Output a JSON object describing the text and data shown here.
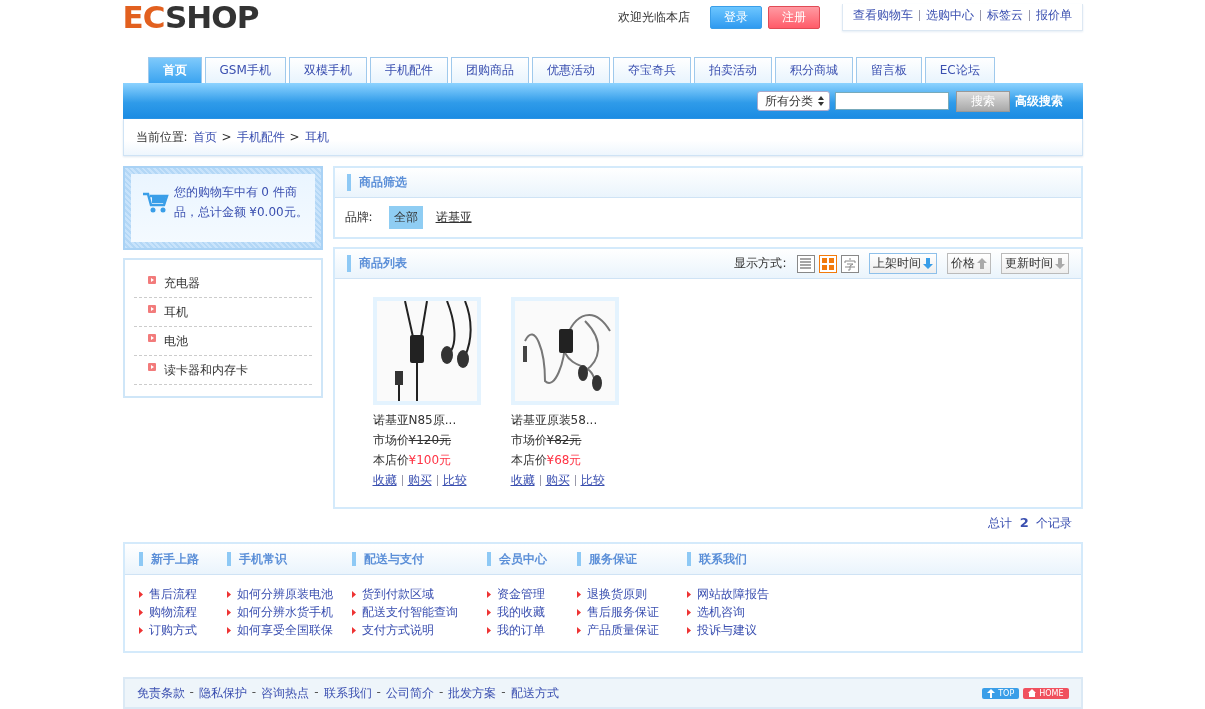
{
  "logo": {
    "prefix": "EC",
    "suffix": "SHOP"
  },
  "welcome": "欢迎光临本店",
  "auth_buttons": [
    {
      "label": "登录",
      "kind": "login"
    },
    {
      "label": "注册",
      "kind": "register"
    }
  ],
  "top_links": [
    "查看购物车",
    "选购中心",
    "标签云",
    "报价单"
  ],
  "nav_tabs": [
    {
      "label": "首页",
      "selected": true
    },
    {
      "label": "GSM手机",
      "selected": false
    },
    {
      "label": "双模手机",
      "selected": false
    },
    {
      "label": "手机配件",
      "selected": false
    },
    {
      "label": "团购商品",
      "selected": false
    },
    {
      "label": "优惠活动",
      "selected": false
    },
    {
      "label": "夺宝奇兵",
      "selected": false
    },
    {
      "label": "拍卖活动",
      "selected": false
    },
    {
      "label": "积分商城",
      "selected": false
    },
    {
      "label": "留言板",
      "selected": false
    },
    {
      "label": "EC论坛",
      "selected": false
    }
  ],
  "search": {
    "category": "所有分类",
    "button": "搜索",
    "advanced": "高级搜索"
  },
  "breadcrumb": {
    "label": "当前位置:",
    "items": [
      "首页",
      "手机配件",
      "耳机"
    ],
    "separator": ">"
  },
  "cart": {
    "text": "您的购物车中有 0 件商品，总计金额 ¥0.00元。"
  },
  "categories": [
    "充电器",
    "耳机",
    "电池",
    "读卡器和内存卡"
  ],
  "filter": {
    "title": "商品筛选",
    "label": "品牌:",
    "brands": [
      {
        "label": "全部",
        "selected": true
      },
      {
        "label": "诺基亚",
        "selected": false
      }
    ]
  },
  "product_list": {
    "title": "商品列表",
    "display_label": "显示方式:",
    "display_modes": [
      {
        "kind": "list",
        "selected": false
      },
      {
        "kind": "grid",
        "selected": true
      },
      {
        "kind": "text",
        "selected": false
      }
    ],
    "sorts": [
      {
        "label": "上架时间",
        "descending": true,
        "selected": true
      },
      {
        "label": "价格",
        "descending": false,
        "selected": false
      },
      {
        "label": "更新时间",
        "descending": true,
        "selected": false
      }
    ],
    "products": [
      {
        "kind": "picture",
        "name": "诺基亚N85原...",
        "market_label": "市场价",
        "market_price": "¥120元",
        "shop_label": "本店价",
        "shop_price": "¥100元",
        "actions": [
          "收藏",
          "购买",
          "比较"
        ]
      },
      {
        "kind": "picture",
        "name": "诺基亚原装58...",
        "market_label": "市场价",
        "market_price": "¥82元",
        "shop_label": "本店价",
        "shop_price": "¥68元",
        "actions": [
          "收藏",
          "购买",
          "比较"
        ]
      }
    ]
  },
  "pager": "总计 **2** 个记录",
  "help_columns": [
    {
      "title": "新手上路",
      "links": [
        "售后流程",
        "购物流程",
        "订购方式"
      ]
    },
    {
      "title": "手机常识",
      "links": [
        "如何分辨原装电池",
        "如何分辨水货手机",
        "如何享受全国联保"
      ]
    },
    {
      "title": "配送与支付",
      "links": [
        "货到付款区域",
        "配送支付智能查询",
        "支付方式说明"
      ]
    },
    {
      "title": "会员中心",
      "links": [
        "资金管理",
        "我的收藏",
        "我的订单"
      ]
    },
    {
      "title": "服务保证",
      "links": [
        "退换货原则",
        "售后服务保证",
        "产品质量保证"
      ]
    },
    {
      "title": "联系我们",
      "links": [
        "网站故障报告",
        "选机咨询",
        "投诉与建议"
      ]
    }
  ],
  "footer_links": [
    "免责条款",
    "隐私保护",
    "咨询热点",
    "联系我们",
    "公司简介",
    "批发方案",
    "配送方式"
  ],
  "footer_separator": "-",
  "footer_buttons": [
    {
      "label": "TOP",
      "kind": "top"
    },
    {
      "label": "HOME",
      "kind": "home"
    }
  ]
}
